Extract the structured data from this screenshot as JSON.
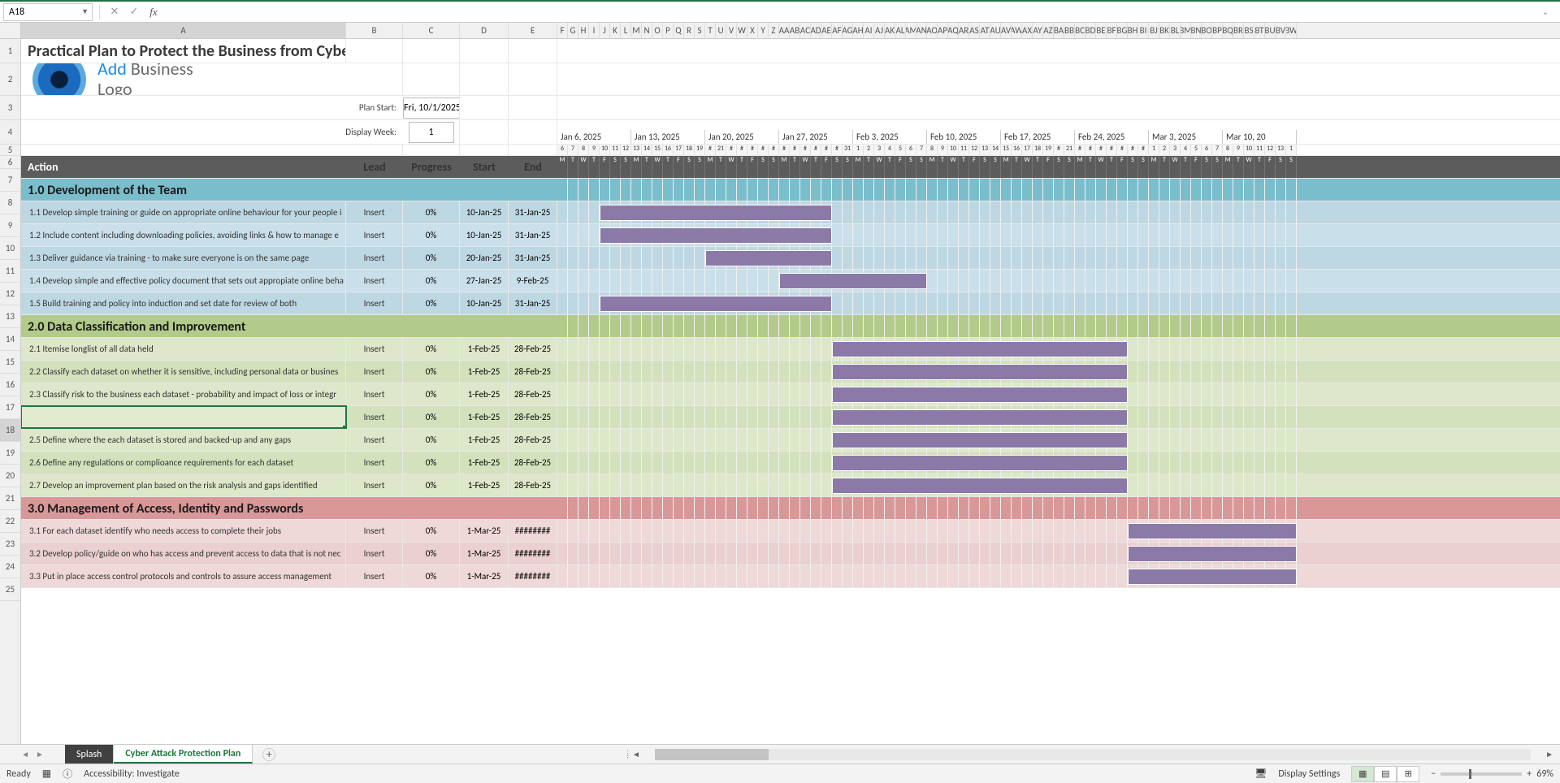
{
  "nameBox": "A18",
  "formula": "",
  "title": "Practical Plan to Protect the Business from Cyber Attack",
  "logo": {
    "line1a": "Add",
    "line1b": "Business",
    "line2": "Logo"
  },
  "planStart": {
    "label": "Plan Start:",
    "value": "Fri, 10/1/2025"
  },
  "displayWeek": {
    "label": "Display Week:",
    "value": "1"
  },
  "headers": {
    "action": "Action",
    "lead": "Lead",
    "progress": "Progress",
    "start": "Start",
    "end": "End"
  },
  "weekHeaders": [
    "Jan 6, 2025",
    "Jan 13, 2025",
    "Jan 20, 2025",
    "Jan 27, 2025",
    "Feb 3, 2025",
    "Feb 10, 2025",
    "Feb 17, 2025",
    "Feb 24, 2025",
    "Mar 3, 2025",
    "Mar 10, 20"
  ],
  "dayNums": [
    "6",
    "7",
    "8",
    "9",
    "10",
    "11",
    "12",
    "13",
    "14",
    "15",
    "16",
    "17",
    "18",
    "19",
    "#",
    "21",
    "#",
    "#",
    "#",
    "#",
    "#",
    "#",
    "#",
    "#",
    "#",
    "#",
    "#",
    "31",
    "1",
    "2",
    "3",
    "4",
    "5",
    "6",
    "7",
    "8",
    "9",
    "10",
    "11",
    "12",
    "13",
    "14",
    "15",
    "16",
    "17",
    "18",
    "19",
    "#",
    "21",
    "#",
    "#",
    "#",
    "#",
    "#",
    "#",
    "#",
    "1",
    "2",
    "3",
    "4",
    "5",
    "6",
    "7",
    "8",
    "9",
    "10",
    "11",
    "12",
    "13",
    "1"
  ],
  "dayLtrs": [
    "M",
    "T",
    "W",
    "T",
    "F",
    "S",
    "S",
    "M",
    "T",
    "W",
    "T",
    "F",
    "S",
    "S",
    "M",
    "T",
    "W",
    "T",
    "F",
    "S",
    "S",
    "M",
    "T",
    "W",
    "T",
    "F",
    "S",
    "S",
    "M",
    "T",
    "W",
    "T",
    "F",
    "S",
    "S",
    "M",
    "T",
    "W",
    "T",
    "F",
    "S",
    "S",
    "M",
    "T",
    "W",
    "T",
    "F",
    "S",
    "S",
    "M",
    "T",
    "W",
    "T",
    "F",
    "S",
    "S",
    "M",
    "T",
    "W",
    "T",
    "F",
    "S",
    "S",
    "M",
    "T",
    "W",
    "T",
    "F",
    "S",
    "S"
  ],
  "colLetters": [
    "A",
    "B",
    "C",
    "D",
    "E",
    "F",
    "G",
    "H",
    "I",
    "J",
    "K",
    "L",
    "M",
    "N",
    "O",
    "P",
    "Q",
    "R",
    "S",
    "T",
    "U",
    "V",
    "W",
    "X",
    "Y",
    "Z",
    "AA",
    "AB",
    "AC",
    "AD",
    "AE",
    "AF",
    "AG",
    "AH",
    "AI",
    "AJ",
    "AK",
    "AL",
    "AM",
    "AN",
    "AO",
    "AP",
    "AQ",
    "AR",
    "AS",
    "AT",
    "AU",
    "AV",
    "AW",
    "AX",
    "AY",
    "AZ",
    "BA",
    "BB",
    "BC",
    "BD",
    "BE",
    "BF",
    "BG",
    "BH",
    "BI",
    "BJ",
    "BK",
    "BL",
    "BM",
    "BN",
    "BO",
    "BP",
    "BQ",
    "BR",
    "BS",
    "BT",
    "BU",
    "BV",
    "BW"
  ],
  "rowNums": [
    "1",
    "2",
    "3",
    "4",
    "5",
    "6",
    "7",
    "8",
    "9",
    "10",
    "11",
    "12",
    "13",
    "14",
    "15",
    "16",
    "17",
    "18",
    "19",
    "20",
    "21",
    "22",
    "23",
    "24",
    "25"
  ],
  "sections": [
    {
      "id": "1.0",
      "title": "1.0 Development of the Team",
      "cls": "sec1",
      "rowNum": 8,
      "tasks": [
        {
          "r": 9,
          "name": "1.1 Develop simple training or guide on appropriate online behaviour for your people i",
          "lead": "Insert",
          "prog": "0%",
          "start": "10-Jan-25",
          "end": "31-Jan-25",
          "barStart": 4,
          "barLen": 22
        },
        {
          "r": 10,
          "name": "1.2  Include content including downloading policies, avoiding links & how to manage e",
          "lead": "Insert",
          "prog": "0%",
          "start": "10-Jan-25",
          "end": "31-Jan-25",
          "barStart": 4,
          "barLen": 22
        },
        {
          "r": 11,
          "name": "1.3 Deliver guidance via training - to make sure everyone is on the same page",
          "lead": "Insert",
          "prog": "0%",
          "start": "20-Jan-25",
          "end": "31-Jan-25",
          "barStart": 14,
          "barLen": 12
        },
        {
          "r": 12,
          "name": "1.4 Develop simple and effective policy document that sets out appropiate online beha",
          "lead": "Insert",
          "prog": "0%",
          "start": "27-Jan-25",
          "end": "9-Feb-25",
          "barStart": 21,
          "barLen": 14
        },
        {
          "r": 13,
          "name": "1.5 Build training and policy into induction and set date for review of both",
          "lead": "Insert",
          "prog": "0%",
          "start": "10-Jan-25",
          "end": "31-Jan-25",
          "barStart": 4,
          "barLen": 22
        }
      ]
    },
    {
      "id": "2.0",
      "title": "2.0 Data Classification and Improvement",
      "cls": "sec2",
      "rowNum": 14,
      "tasks": [
        {
          "r": 15,
          "name": "2.1 Itemise longlist of all data held",
          "lead": "Insert",
          "prog": "0%",
          "start": "1-Feb-25",
          "end": "28-Feb-25",
          "barStart": 26,
          "barLen": 28
        },
        {
          "r": 16,
          "name": "2.2 Classify each dataset on whether it is sensitive, including personal data or busines",
          "lead": "Insert",
          "prog": "0%",
          "start": "1-Feb-25",
          "end": "28-Feb-25",
          "barStart": 26,
          "barLen": 28
        },
        {
          "r": 17,
          "name": "2.3 Classify risk to the business each dataset - probability and impact of loss or integr",
          "lead": "Insert",
          "prog": "0%",
          "start": "1-Feb-25",
          "end": "28-Feb-25",
          "barStart": 26,
          "barLen": 28
        },
        {
          "r": 18,
          "name": "",
          "lead": "Insert",
          "prog": "0%",
          "start": "1-Feb-25",
          "end": "28-Feb-25",
          "barStart": 26,
          "barLen": 28,
          "selected": true
        },
        {
          "r": 19,
          "name": "2.5 Define where the each dataset is stored and backed-up and any gaps",
          "lead": "Insert",
          "prog": "0%",
          "start": "1-Feb-25",
          "end": "28-Feb-25",
          "barStart": 26,
          "barLen": 28
        },
        {
          "r": 20,
          "name": "2.6 Define any regulations or complioance requirements for each dataset",
          "lead": "Insert",
          "prog": "0%",
          "start": "1-Feb-25",
          "end": "28-Feb-25",
          "barStart": 26,
          "barLen": 28
        },
        {
          "r": 21,
          "name": "2.7 Develop an improvement plan based on the risk analysis and gaps identified",
          "lead": "Insert",
          "prog": "0%",
          "start": "1-Feb-25",
          "end": "28-Feb-25",
          "barStart": 26,
          "barLen": 28
        }
      ]
    },
    {
      "id": "3.0",
      "title": "3.0 Management of Access, Identity and Passwords",
      "cls": "sec3",
      "rowNum": 22,
      "tasks": [
        {
          "r": 23,
          "name": "3.1 For each dataset identify who needs access to complete their jobs",
          "lead": "Insert",
          "prog": "0%",
          "start": "1-Mar-25",
          "end": "########",
          "barStart": 54,
          "barLen": 16
        },
        {
          "r": 24,
          "name": "3.2 Develop policy/guide on who has access and prevent access to data that is not nec",
          "lead": "Insert",
          "prog": "0%",
          "start": "1-Mar-25",
          "end": "########",
          "barStart": 54,
          "barLen": 16
        },
        {
          "r": 25,
          "name": "3.3 Put in place access control protocols and controls to assure access management",
          "lead": "Insert",
          "prog": "0%",
          "start": "1-Mar-25",
          "end": "########",
          "barStart": 54,
          "barLen": 16
        }
      ]
    }
  ],
  "tabs": [
    {
      "name": "Splash",
      "active": false
    },
    {
      "name": "Cyber Attack Protection Plan",
      "active": true
    }
  ],
  "status": {
    "ready": "Ready",
    "accessibility": "Accessibility: Investigate",
    "display": "Display Settings",
    "zoom": "69%"
  }
}
